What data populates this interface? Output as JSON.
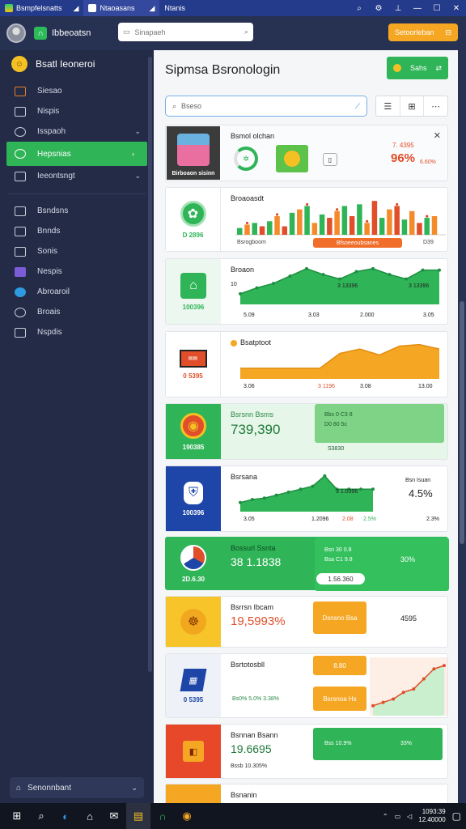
{
  "window": {
    "tabs": [
      {
        "label": "Bsmpfelsnatts"
      },
      {
        "label": "Ntaoasans"
      },
      {
        "label": "Ntanis"
      }
    ]
  },
  "appbar": {
    "brand": "Ibbeoatsn",
    "search_placeholder": "Sinapaeh",
    "primary_button": "Setoorleban"
  },
  "sidebar": {
    "header": "Bsatl Ieoneroi",
    "items": [
      {
        "label": "Siesao",
        "icon": "grid-icon"
      },
      {
        "label": "Nispis",
        "icon": "document-icon"
      },
      {
        "label": "Isspaoh",
        "icon": "gear-icon",
        "chevron": true
      },
      {
        "label": "Hepsnias",
        "icon": "clock-icon",
        "chevron": true,
        "active": true
      },
      {
        "label": "Ieeontsngt",
        "icon": "bookmark-icon",
        "chevron": true
      }
    ],
    "items2": [
      {
        "label": "Bsndsns",
        "icon": "list-icon"
      },
      {
        "label": "Bnnds",
        "icon": "chart-icon"
      },
      {
        "label": "Sonis",
        "icon": "file-icon"
      },
      {
        "label": "Nespis",
        "icon": "puzzle-icon"
      },
      {
        "label": "Abroaroil",
        "icon": "cloud-icon"
      },
      {
        "label": "Broais",
        "icon": "search-icon"
      },
      {
        "label": "Nspdis",
        "icon": "tag-icon"
      }
    ],
    "footer": "Senonnbant"
  },
  "main": {
    "title": "Sipmsa Bsronologin",
    "export_label": "Sahs",
    "search_placeholder": "Bseso"
  },
  "cards": [
    {
      "title": "Bsmol olchan",
      "thumb_caption": "Birboaon sisinn",
      "stat1": "7. 4395",
      "stat2": "96%",
      "stat3": "6.60%"
    },
    {
      "title": "Broaoasdt",
      "thumb_value": "D 2896",
      "x_label": "Bsrogboom",
      "pill": "Bfsoeeoubsanes",
      "x_right": "D39"
    },
    {
      "title": "Broaon",
      "thumb_value": "100396",
      "y_label": "10",
      "annot1": "3 13396",
      "annot2": "3 13396",
      "ticks": [
        "5.09",
        "3.03",
        "2.000",
        "3.05"
      ]
    },
    {
      "title": "Bsatptoot",
      "thumb_value": "0 5395",
      "ticks": [
        "3.06",
        "3 1196",
        "3.08",
        "13.00"
      ]
    },
    {
      "title": "Bsrsnn Bsms",
      "thumb_value": "190385",
      "big_value": "739,390",
      "box1": "Bbs 0 C3 8",
      "box2": "D0 80 5c",
      "box3": "S3830"
    },
    {
      "title": "Bsrsana",
      "thumb_value": "100396",
      "annot": "3 1.0396",
      "right_label": "Bsn Isuan",
      "right_value": "4.5%",
      "ticks": [
        "3.05",
        "1.2096",
        "2.08",
        "2.5%",
        "2.3%"
      ]
    },
    {
      "title": "Bossurl Ssnta",
      "thumb_value": "2D.6.30",
      "big_value": "38 1.1838",
      "box1": "Bsn 30 0.8",
      "box2": "Bsa C1 9.8",
      "pct": "30%",
      "pill": "1.56.360"
    },
    {
      "title": "Bsrrsn Ibcam",
      "big_value": "19,5993%",
      "pill": "Dsnsno Bsa",
      "right_value": "4595"
    },
    {
      "title": "Bsrtotosbll",
      "thumb_value": "0 5395",
      "values": "Bs0% 5.0% 3.38%",
      "pill1": "8.80",
      "pill2": "Bsrsnoa Hs"
    },
    {
      "title": "Bsnnan Bsann",
      "big_value": "19.6695",
      "sub": "Bssb 10.305%",
      "pill1": "Bss 10.9%",
      "pill2": "33%"
    },
    {
      "title": "Bsnanin"
    }
  ],
  "taskbar": {
    "time": "1093:39",
    "date": "12.40000"
  },
  "colors": {
    "green": "#2fb457",
    "orange": "#f5a623",
    "red": "#e04e2a",
    "navy": "#232b47"
  },
  "chart_data": [
    {
      "type": "bar",
      "categories": [
        "1",
        "2",
        "3",
        "4",
        "5",
        "6",
        "7",
        "8",
        "9",
        "10",
        "11",
        "12",
        "13",
        "14",
        "15",
        "16",
        "17",
        "18",
        "19",
        "20",
        "21",
        "22",
        "23",
        "24",
        "25",
        "26",
        "27"
      ],
      "series": [
        {
          "values": [
            8,
            12,
            14,
            10,
            16,
            22,
            10,
            26,
            30,
            34,
            14,
            24,
            20,
            28,
            34,
            22,
            36,
            14,
            40,
            20,
            30,
            34,
            18,
            28,
            14,
            20,
            22
          ]
        },
        {
          "values": [
            6,
            10,
            12,
            8,
            12,
            18,
            8,
            22,
            24,
            30,
            10,
            20,
            16,
            22,
            30,
            18,
            30,
            10,
            34,
            16,
            24,
            28,
            14,
            22,
            10,
            16,
            18
          ]
        }
      ]
    },
    {
      "type": "area",
      "x": [
        0,
        1,
        2,
        3,
        4,
        5,
        6,
        7,
        8,
        9,
        10,
        11,
        12
      ],
      "values": [
        10,
        18,
        24,
        34,
        44,
        36,
        30,
        40,
        44,
        36,
        30,
        42,
        42
      ]
    },
    {
      "type": "area",
      "x": [
        0,
        1,
        2,
        3,
        4,
        5,
        6,
        7,
        8,
        9,
        10
      ],
      "values": [
        10,
        10,
        10,
        10,
        10,
        30,
        36,
        28,
        40,
        42,
        36
      ]
    },
    {
      "type": "area",
      "x": [
        0,
        1,
        2,
        3,
        4,
        5,
        6,
        7,
        8,
        9,
        10,
        11
      ],
      "values": [
        8,
        12,
        14,
        18,
        22,
        26,
        30,
        44,
        26,
        26,
        26,
        26
      ]
    },
    {
      "type": "line",
      "x": [
        0,
        1,
        2,
        3,
        4,
        5,
        6,
        7
      ],
      "values": [
        4,
        6,
        8,
        12,
        14,
        20,
        26,
        28
      ]
    }
  ]
}
